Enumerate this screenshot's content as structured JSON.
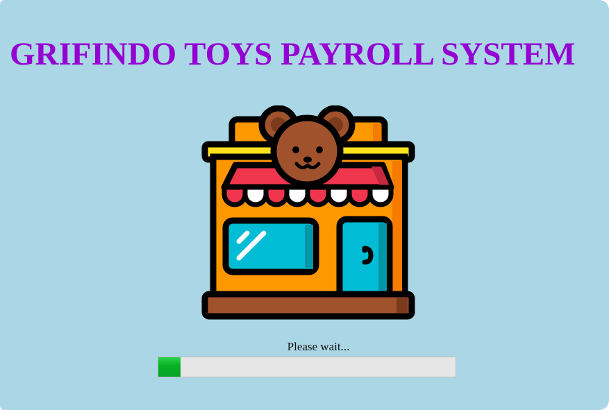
{
  "window": {
    "title": "GRIFINDO TOYS PAYROLL SYSTEM",
    "background_color": "#abd6e5",
    "title_color": "#9400d3"
  },
  "logo": {
    "icon": "toy-shop-teddy-bear-icon"
  },
  "loading": {
    "status_text": "Please wait...",
    "progress_fraction": 0.075,
    "progress_color": "#06b025"
  }
}
